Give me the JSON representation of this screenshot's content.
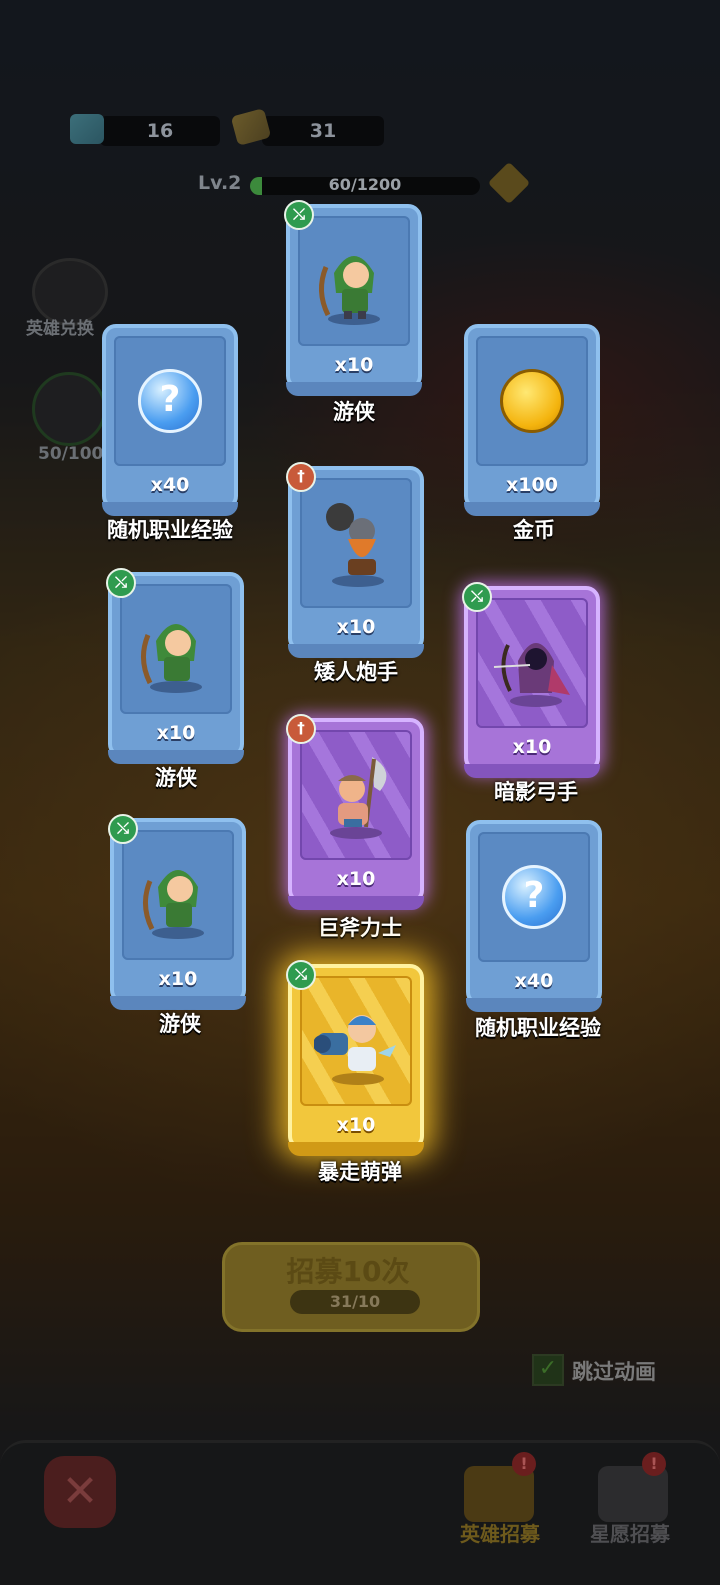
{
  "header": {
    "gems": "16",
    "tickets": "31",
    "level": "Lv.2",
    "xp": "60/1200",
    "xp_fraction": 0.05
  },
  "side": {
    "hero_exchange": "英雄兑换",
    "progress": "50/100"
  },
  "cards": [
    {
      "qty": "x10",
      "name": "游侠"
    },
    {
      "qty": "x40",
      "name": "随机职业经验"
    },
    {
      "qty": "x100",
      "name": "金币"
    },
    {
      "qty": "x10",
      "name": "矮人炮手"
    },
    {
      "qty": "x10",
      "name": "游侠"
    },
    {
      "qty": "x10",
      "name": "暗影弓手"
    },
    {
      "qty": "x10",
      "name": "巨斧力士"
    },
    {
      "qty": "x10",
      "name": "游侠"
    },
    {
      "qty": "x40",
      "name": "随机职业经验"
    },
    {
      "qty": "x10",
      "name": "暴走萌弹"
    }
  ],
  "recruit": {
    "label": "招募10次",
    "tickets": "31/10"
  },
  "skip": {
    "label": "跳过动画",
    "checked": true
  },
  "bottom_tabs": {
    "hero_recruit": "英雄招募",
    "star_recruit": "星愿招募"
  },
  "colors": {
    "blue_card": "#6f9fd4",
    "purple_card": "#a774d8",
    "gold_card": "#f2c73c"
  }
}
